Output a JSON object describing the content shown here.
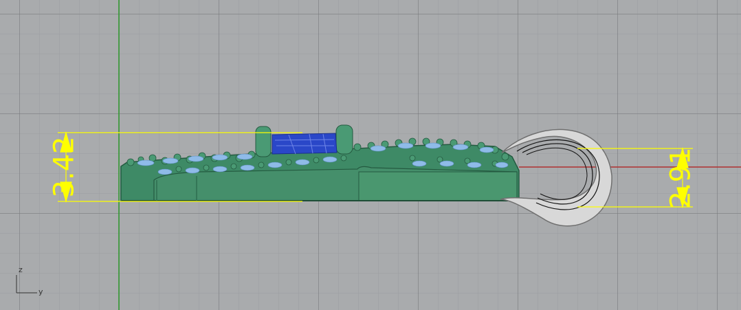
{
  "viewport": {
    "background": "#a9abad",
    "axis_x_color": "#b03030",
    "axis_z_color": "#2d9a2d"
  },
  "model": {
    "metal_color": "#3e8a66",
    "stone_color": "#8fbbe8",
    "center_stone_color": "#2a47c8",
    "bail_color": "#d8d8d8"
  },
  "dimensions": {
    "color": "#ffff00",
    "left_height": "3.42",
    "right_height": "2.91"
  },
  "axis_indicator": {
    "vertical_label": "z",
    "horizontal_label": "y"
  }
}
